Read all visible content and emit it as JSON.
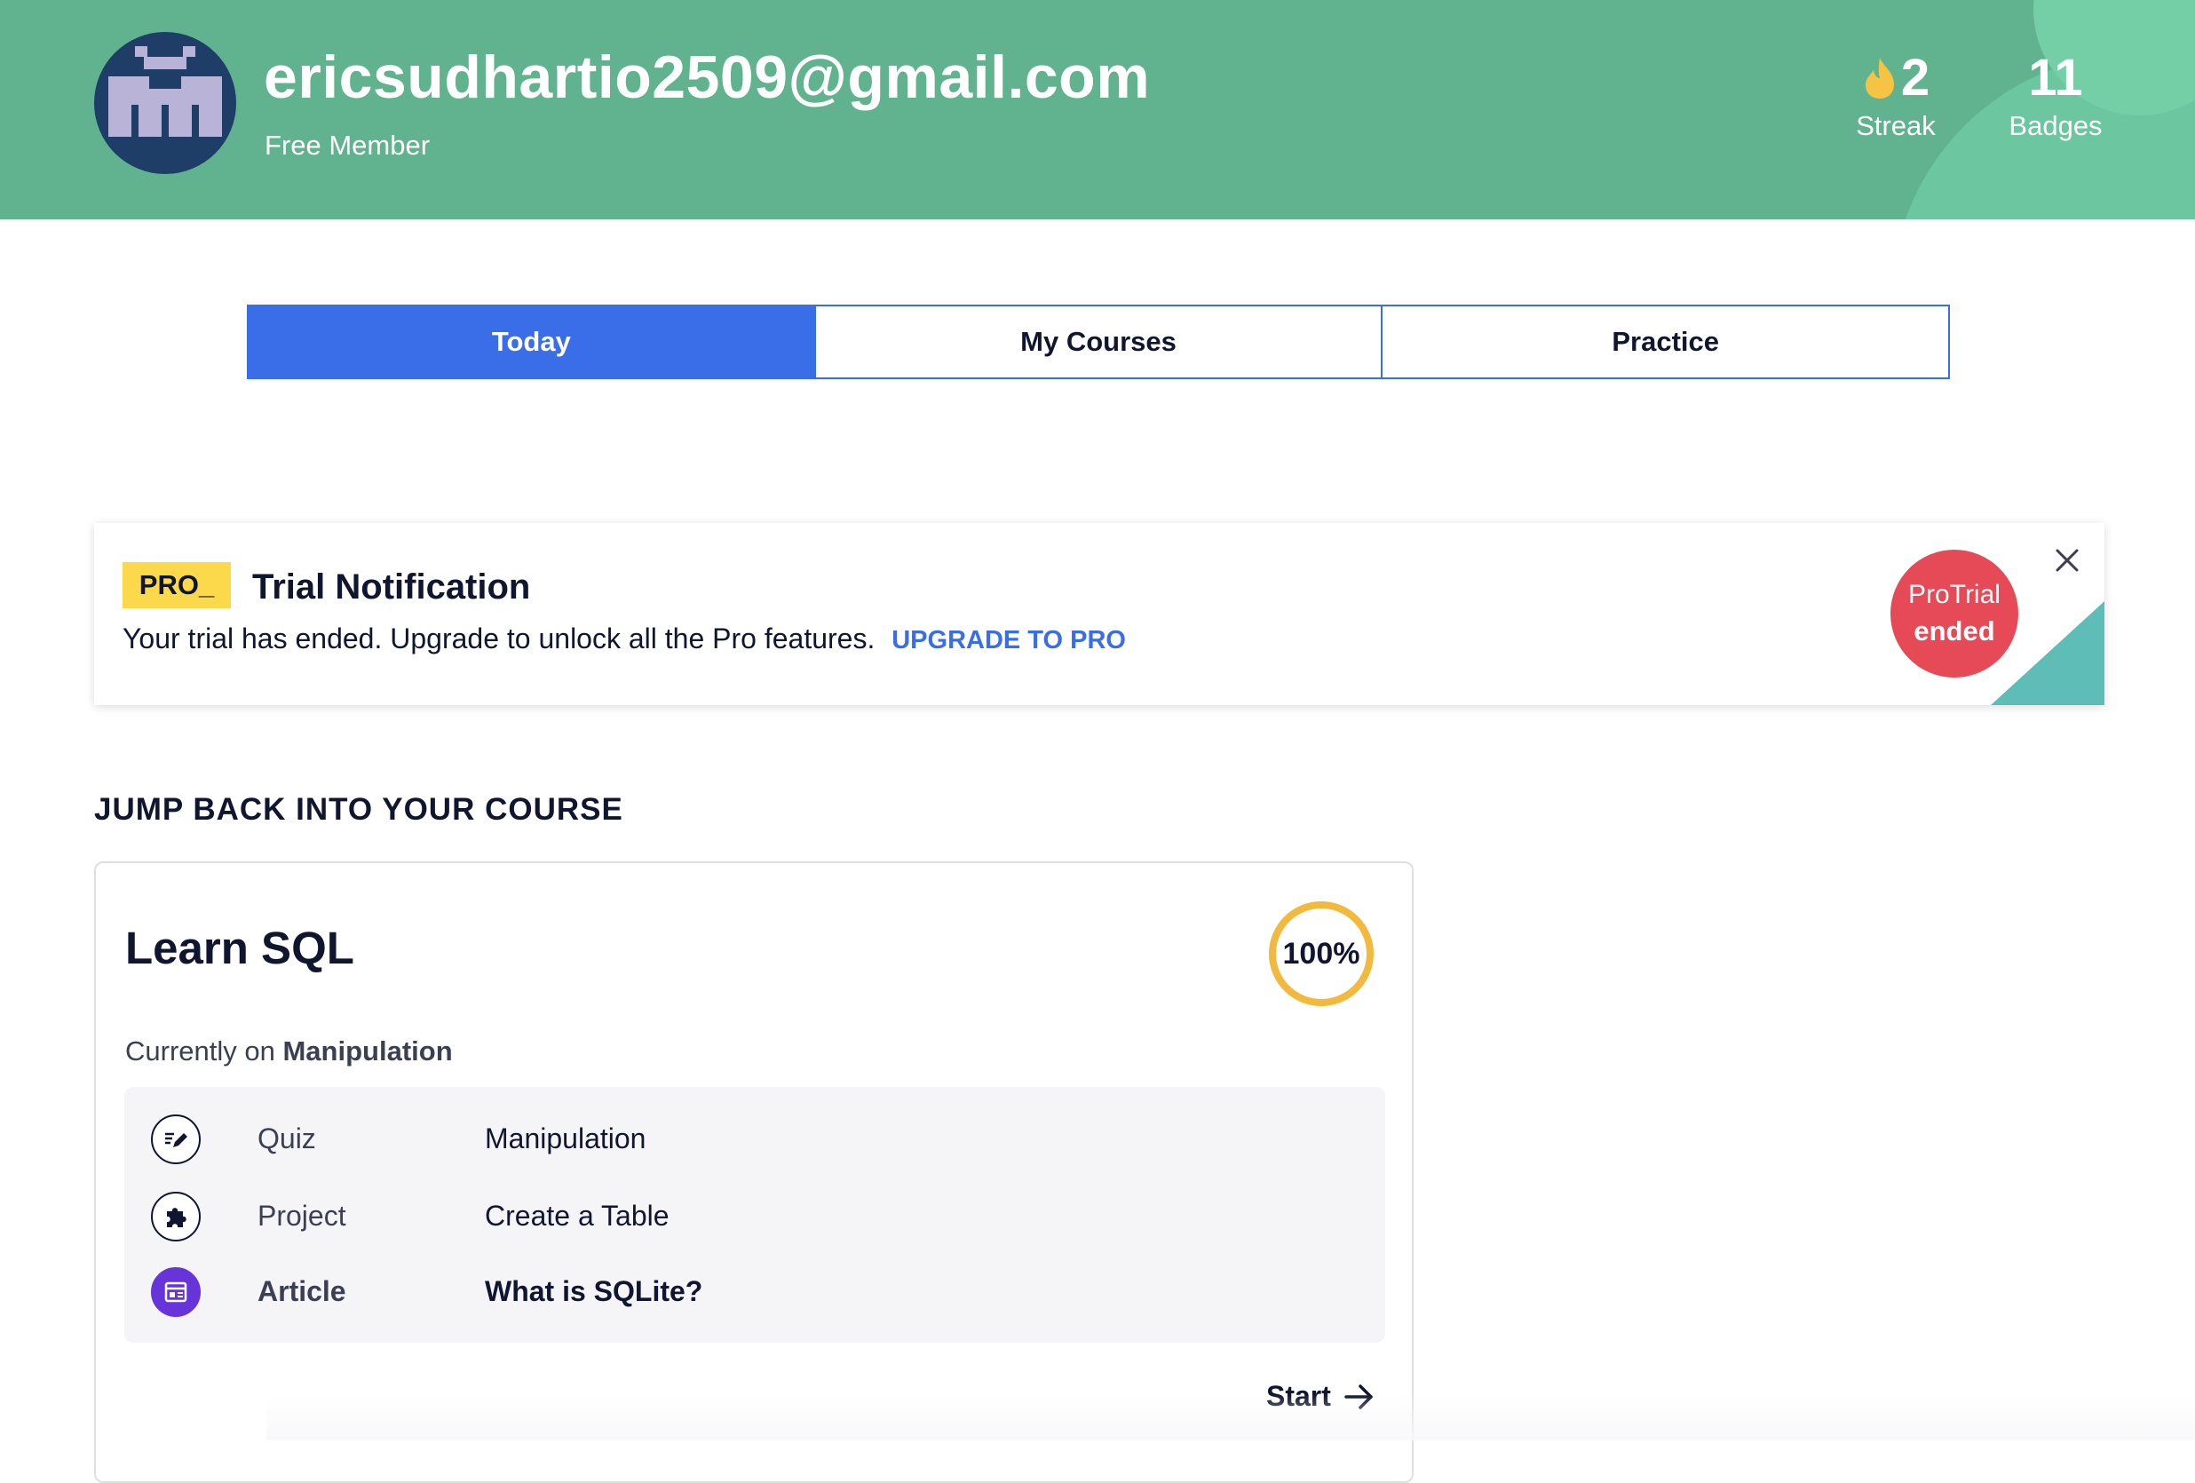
{
  "header": {
    "email": "ericsudhartio2509@gmail.com",
    "membership": "Free Member",
    "avatar_icon": "pixel-invader-avatar",
    "stats": {
      "streak_value": "2",
      "streak_label": "Streak",
      "streak_icon": "flame-icon",
      "badges_value": "11",
      "badges_label": "Badges"
    },
    "colors": {
      "header_bg": "#61b38f"
    }
  },
  "tabs": [
    {
      "label": "Today",
      "active": true
    },
    {
      "label": "My Courses",
      "active": false
    },
    {
      "label": "Practice",
      "active": false
    }
  ],
  "notification": {
    "badge": "PRO_",
    "title": "Trial Notification",
    "message": "Your trial has ended. Upgrade to unlock all the Pro features.",
    "link": "UPGRADE TO PRO",
    "status_line1": "ProTrial",
    "status_line2": "ended",
    "close_icon": "close-icon"
  },
  "course_section": {
    "heading": "JUMP BACK INTO YOUR COURSE",
    "course": {
      "title": "Learn SQL",
      "progress_label": "100%",
      "progress_value": 1.0,
      "currently_prefix": "Currently on",
      "currently_module": "Manipulation",
      "items": [
        {
          "type": "Quiz",
          "name": "Manipulation",
          "icon": "quiz-pencil-icon"
        },
        {
          "type": "Project",
          "name": "Create a Table",
          "icon": "puzzle-icon"
        },
        {
          "type": "Article",
          "name": "What is SQLite?",
          "icon": "article-icon"
        }
      ],
      "start_label": "Start",
      "start_icon": "arrow-right-icon"
    }
  }
}
